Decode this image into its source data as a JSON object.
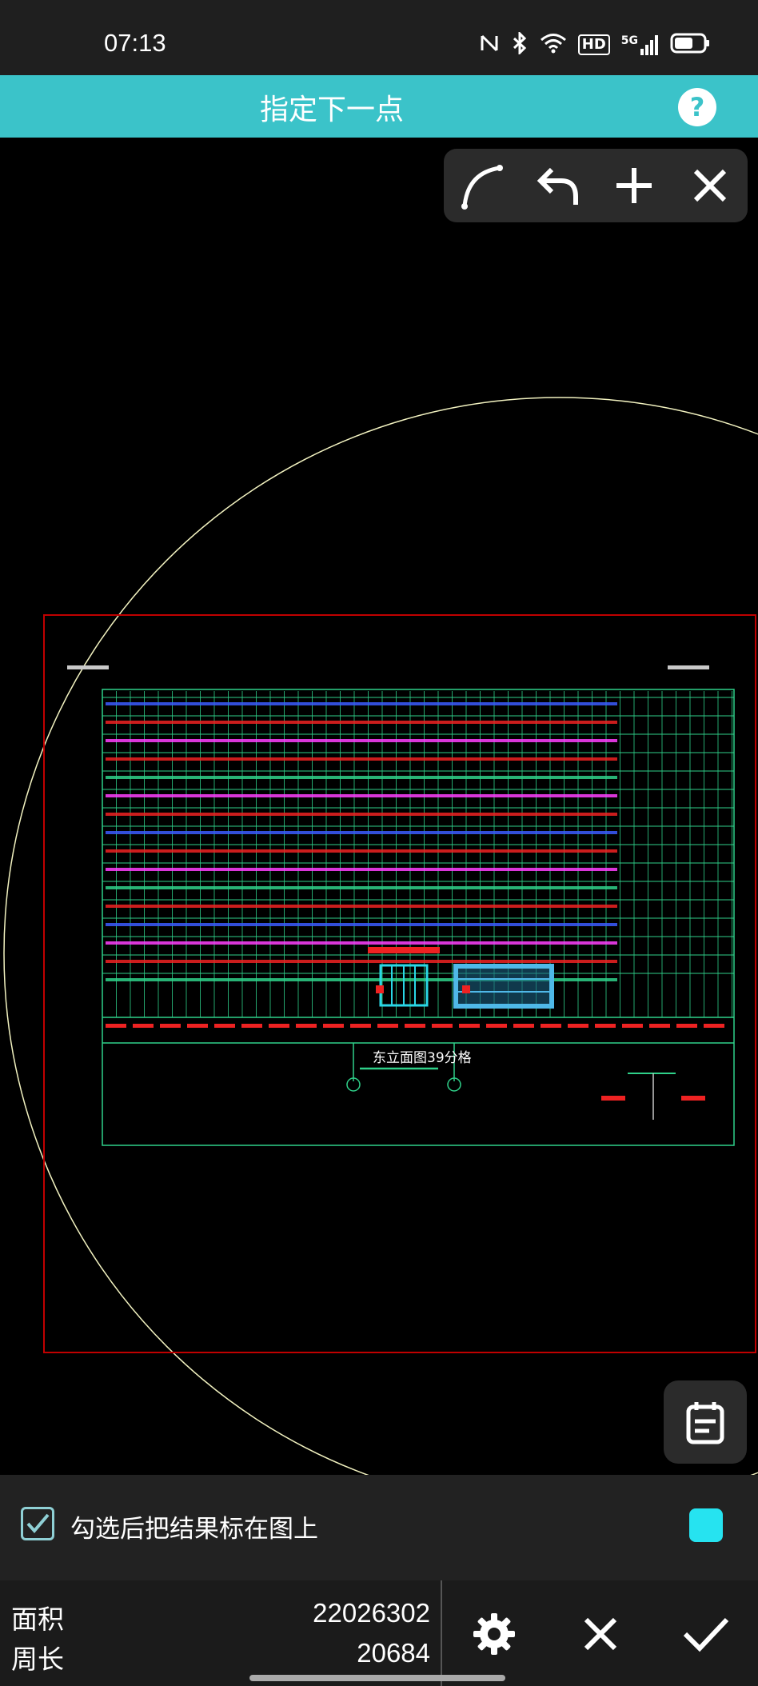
{
  "status_bar": {
    "time": "07:13",
    "icons": [
      "nfc-icon",
      "bluetooth-icon",
      "wifi-icon",
      "hd-icon",
      "5g-signal-icon",
      "battery-icon"
    ],
    "hd_label": "HD",
    "network_label": "5G"
  },
  "title_bar": {
    "title": "指定下一点",
    "help_label": "?"
  },
  "toolbar": {
    "tools": [
      "arc-icon",
      "undo-icon",
      "add-icon",
      "close-icon"
    ]
  },
  "drawing": {
    "title": "东立面图39分格",
    "frame_color": "#c00000",
    "circle_color": "#f2f2c0"
  },
  "mark_row": {
    "checkbox_checked": true,
    "label": "勾选后把结果标在图上",
    "color": "#26e3f0"
  },
  "results": {
    "area_label": "面积",
    "area_value": "22026302",
    "perimeter_label": "周长",
    "perimeter_value": "20684"
  },
  "colors": {
    "accent": "#3bc3c9",
    "panel": "#2b2b2b"
  }
}
